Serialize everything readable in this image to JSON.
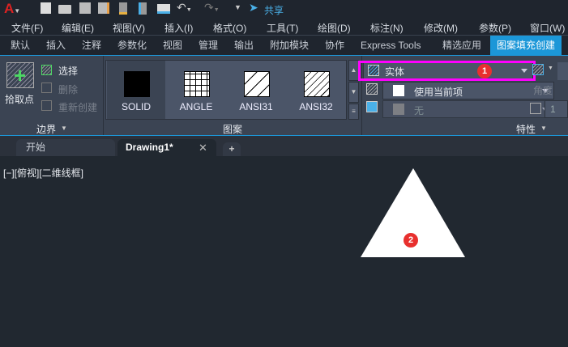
{
  "qat": {
    "share_label": "共享",
    "icons": [
      "autocad-logo-icon",
      "new-icon",
      "open-icon",
      "save-icon",
      "save-as-icon",
      "open-from-cloud-icon",
      "save-to-cloud-icon",
      "print-icon",
      "undo-icon",
      "redo-icon",
      "customize-icon",
      "share-icon"
    ]
  },
  "menu": [
    "文件(F)",
    "编辑(E)",
    "视图(V)",
    "插入(I)",
    "格式(O)",
    "工具(T)",
    "绘图(D)",
    "标注(N)",
    "修改(M)",
    "参数(P)",
    "窗口(W)"
  ],
  "ribbon_tabs": [
    "默认",
    "插入",
    "注释",
    "参数化",
    "视图",
    "管理",
    "输出",
    "附加模块",
    "协作",
    "Express Tools",
    "精选应用",
    "图案填充创建"
  ],
  "ribbon_active_tab": "图案填充创建",
  "boundary": {
    "pick_points": "拾取点",
    "select": "选择",
    "remove": "删除",
    "recreate": "重新创建",
    "panel_label": "边界"
  },
  "pattern": {
    "items": [
      "SOLID",
      "ANGLE",
      "ANSI31",
      "ANSI32"
    ],
    "selected": "SOLID",
    "panel_label": "图案"
  },
  "properties": {
    "type": "实体",
    "color": "使用当前项",
    "background": "无",
    "angle_label": "角度",
    "scale": "1",
    "panel_label": "特性"
  },
  "file_tabs": {
    "start": "开始",
    "drawing": "Drawing1*"
  },
  "viewport_label": "[−][俯视][二维线框]",
  "markers": [
    "1",
    "2"
  ],
  "colors": {
    "accent": "#1c97d8",
    "highlight": "#ff00ff",
    "marker": "#e8302e"
  }
}
